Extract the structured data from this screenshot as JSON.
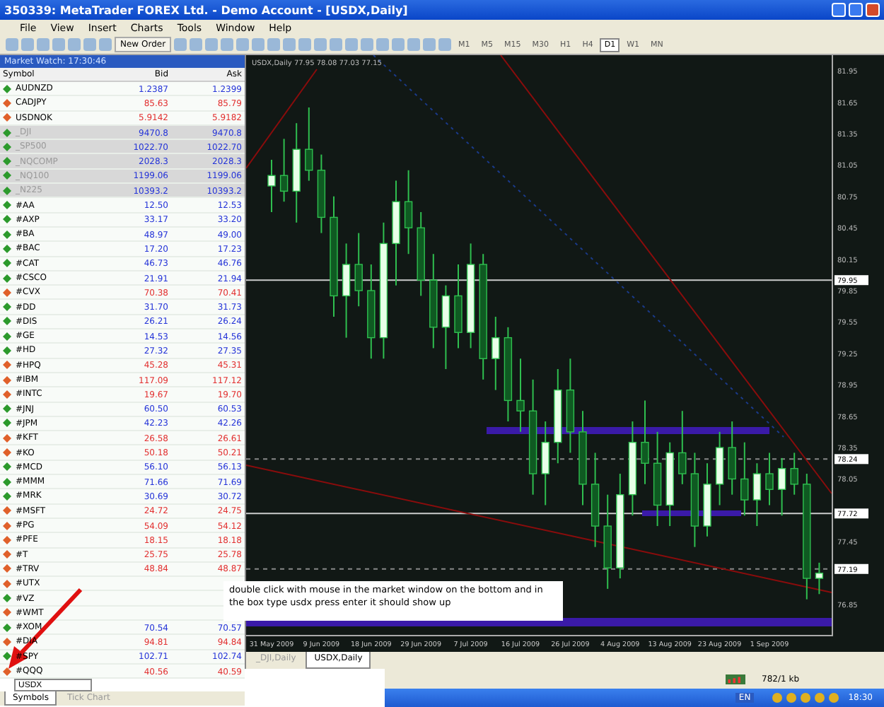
{
  "window": {
    "title": "350339: MetaTrader FOREX Ltd. - Demo Account - [USDX,Daily]"
  },
  "menu": [
    "File",
    "View",
    "Insert",
    "Charts",
    "Tools",
    "Window",
    "Help"
  ],
  "toolbar": {
    "new_order": "New Order",
    "timeframes": [
      {
        "label": "M1",
        "selected": false
      },
      {
        "label": "M5",
        "selected": false
      },
      {
        "label": "M15",
        "selected": false
      },
      {
        "label": "M30",
        "selected": false
      },
      {
        "label": "H1",
        "selected": false
      },
      {
        "label": "H4",
        "selected": false
      },
      {
        "label": "D1",
        "selected": true
      },
      {
        "label": "W1",
        "selected": false
      },
      {
        "label": "MN",
        "selected": false
      }
    ]
  },
  "watch": {
    "title": "Market Watch: 17:30:46",
    "columns": [
      "Symbol",
      "Bid",
      "Ask"
    ],
    "rows": [
      {
        "symbol": "AUDNZD",
        "bid": "1.2387",
        "ask": "1.2399",
        "kind": "up",
        "highlighted": false
      },
      {
        "symbol": "CADJPY",
        "bid": "85.63",
        "ask": "85.79",
        "kind": "down",
        "highlighted": false
      },
      {
        "symbol": "USDNOK",
        "bid": "5.9142",
        "ask": "5.9182",
        "kind": "down",
        "highlighted": false
      },
      {
        "symbol": "_DJI",
        "bid": "9470.8",
        "ask": "9470.8",
        "kind": "up",
        "highlighted": true
      },
      {
        "symbol": "_SP500",
        "bid": "1022.70",
        "ask": "1022.70",
        "kind": "up",
        "highlighted": true
      },
      {
        "symbol": "_NQCOMP",
        "bid": "2028.3",
        "ask": "2028.3",
        "kind": "up",
        "highlighted": true
      },
      {
        "symbol": "_NQ100",
        "bid": "1199.06",
        "ask": "1199.06",
        "kind": "up",
        "highlighted": true
      },
      {
        "symbol": "_N225",
        "bid": "10393.2",
        "ask": "10393.2",
        "kind": "up",
        "highlighted": true
      },
      {
        "symbol": "#AA",
        "bid": "12.50",
        "ask": "12.53",
        "kind": "up",
        "highlighted": false
      },
      {
        "symbol": "#AXP",
        "bid": "33.17",
        "ask": "33.20",
        "kind": "up",
        "highlighted": false
      },
      {
        "symbol": "#BA",
        "bid": "48.97",
        "ask": "49.00",
        "kind": "up",
        "highlighted": false
      },
      {
        "symbol": "#BAC",
        "bid": "17.20",
        "ask": "17.23",
        "kind": "up",
        "highlighted": false
      },
      {
        "symbol": "#CAT",
        "bid": "46.73",
        "ask": "46.76",
        "kind": "up",
        "highlighted": false
      },
      {
        "symbol": "#CSCO",
        "bid": "21.91",
        "ask": "21.94",
        "kind": "up",
        "highlighted": false
      },
      {
        "symbol": "#CVX",
        "bid": "70.38",
        "ask": "70.41",
        "kind": "down",
        "highlighted": false
      },
      {
        "symbol": "#DD",
        "bid": "31.70",
        "ask": "31.73",
        "kind": "up",
        "highlighted": false
      },
      {
        "symbol": "#DIS",
        "bid": "26.21",
        "ask": "26.24",
        "kind": "up",
        "highlighted": false
      },
      {
        "symbol": "#GE",
        "bid": "14.53",
        "ask": "14.56",
        "kind": "up",
        "highlighted": false
      },
      {
        "symbol": "#HD",
        "bid": "27.32",
        "ask": "27.35",
        "kind": "up",
        "highlighted": false
      },
      {
        "symbol": "#HPQ",
        "bid": "45.28",
        "ask": "45.31",
        "kind": "down",
        "highlighted": false
      },
      {
        "symbol": "#IBM",
        "bid": "117.09",
        "ask": "117.12",
        "kind": "down",
        "highlighted": false
      },
      {
        "symbol": "#INTC",
        "bid": "19.67",
        "ask": "19.70",
        "kind": "down",
        "highlighted": false
      },
      {
        "symbol": "#JNJ",
        "bid": "60.50",
        "ask": "60.53",
        "kind": "up",
        "highlighted": false
      },
      {
        "symbol": "#JPM",
        "bid": "42.23",
        "ask": "42.26",
        "kind": "up",
        "highlighted": false
      },
      {
        "symbol": "#KFT",
        "bid": "26.58",
        "ask": "26.61",
        "kind": "down",
        "highlighted": false
      },
      {
        "symbol": "#KO",
        "bid": "50.18",
        "ask": "50.21",
        "kind": "down",
        "highlighted": false
      },
      {
        "symbol": "#MCD",
        "bid": "56.10",
        "ask": "56.13",
        "kind": "up",
        "highlighted": false
      },
      {
        "symbol": "#MMM",
        "bid": "71.66",
        "ask": "71.69",
        "kind": "up",
        "highlighted": false
      },
      {
        "symbol": "#MRK",
        "bid": "30.69",
        "ask": "30.72",
        "kind": "up",
        "highlighted": false
      },
      {
        "symbol": "#MSFT",
        "bid": "24.72",
        "ask": "24.75",
        "kind": "down",
        "highlighted": false
      },
      {
        "symbol": "#PG",
        "bid": "54.09",
        "ask": "54.12",
        "kind": "down",
        "highlighted": false
      },
      {
        "symbol": "#PFE",
        "bid": "18.15",
        "ask": "18.18",
        "kind": "down",
        "highlighted": false
      },
      {
        "symbol": "#T",
        "bid": "25.75",
        "ask": "25.78",
        "kind": "down",
        "highlighted": false
      },
      {
        "symbol": "#TRV",
        "bid": "48.84",
        "ask": "48.87",
        "kind": "down",
        "highlighted": false
      },
      {
        "symbol": "#UTX",
        "kind": "down",
        "highlighted": false
      },
      {
        "symbol": "#VZ",
        "kind": "up",
        "highlighted": false
      },
      {
        "symbol": "#WMT",
        "kind": "down",
        "highlighted": false
      },
      {
        "symbol": "#XOM",
        "bid": "70.54",
        "ask": "70.57",
        "kind": "up",
        "highlighted": false
      },
      {
        "symbol": "#DIA",
        "bid": "94.81",
        "ask": "94.84",
        "kind": "down",
        "highlighted": false
      },
      {
        "symbol": "#SPY",
        "bid": "102.71",
        "ask": "102.74",
        "kind": "up",
        "highlighted": false
      },
      {
        "symbol": "#QQQ",
        "bid": "40.56",
        "ask": "40.59",
        "kind": "down",
        "highlighted": false
      }
    ],
    "input": "USDX",
    "tabs": [
      {
        "label": "Symbols",
        "selected": true
      },
      {
        "label": "Tick Chart",
        "selected": false
      }
    ]
  },
  "note": "double click with mouse in the market window on the bottom and in the box type usdx press enter it should show up",
  "chart": {
    "header": "USDX,Daily  77.95 78.08 77.03 77.15",
    "markers": [
      {
        "text": "79.95",
        "kind": "solid"
      },
      {
        "text": "78.24",
        "kind": "dashed"
      },
      {
        "text": "77.72",
        "kind": "solid"
      },
      {
        "text": "77.19",
        "kind": "dashed"
      }
    ],
    "chart_data": {
      "type": "candlestick",
      "ylim": [
        76.56,
        82.1
      ],
      "categories": [
        "31 May 2009",
        null,
        null,
        null,
        "9 Jun 2009",
        null,
        null,
        null,
        "18 Jun 2009",
        null,
        null,
        null,
        "29 Jun 2009",
        null,
        null,
        null,
        "7 Jul 2009",
        null,
        null,
        null,
        "16 Jul 2009",
        null,
        null,
        null,
        "26 Jul 2009",
        null,
        null,
        null,
        "4 Aug 2009",
        null,
        null,
        null,
        "13 Aug 2009",
        null,
        null,
        null,
        "23 Aug 2009",
        null,
        null,
        null,
        "1 Sep 2009",
        null,
        null,
        null,
        null
      ],
      "yticks": [
        81.95,
        81.65,
        81.35,
        81.05,
        80.75,
        80.45,
        80.15,
        79.85,
        79.55,
        79.25,
        78.95,
        78.65,
        78.35,
        78.05,
        77.45,
        76.85
      ],
      "ohlc": [
        [
          80.85,
          81.1,
          80.6,
          80.95
        ],
        [
          80.95,
          81.3,
          80.7,
          80.8
        ],
        [
          80.8,
          81.45,
          80.5,
          81.2
        ],
        [
          81.2,
          81.6,
          80.9,
          81.0
        ],
        [
          81.0,
          81.15,
          80.4,
          80.55
        ],
        [
          80.55,
          80.75,
          79.6,
          79.8
        ],
        [
          79.8,
          80.3,
          79.4,
          80.1
        ],
        [
          80.1,
          80.4,
          79.7,
          79.85
        ],
        [
          79.85,
          80.1,
          79.2,
          79.4
        ],
        [
          79.4,
          80.5,
          79.2,
          80.3
        ],
        [
          80.3,
          80.9,
          79.9,
          80.7
        ],
        [
          80.7,
          81.0,
          80.2,
          80.45
        ],
        [
          80.45,
          80.6,
          79.8,
          79.95
        ],
        [
          79.95,
          80.2,
          79.3,
          79.5
        ],
        [
          79.5,
          79.9,
          79.1,
          79.8
        ],
        [
          79.8,
          80.1,
          79.3,
          79.45
        ],
        [
          79.45,
          80.3,
          79.3,
          80.1
        ],
        [
          80.1,
          80.2,
          79.0,
          79.2
        ],
        [
          79.2,
          79.6,
          78.9,
          79.4
        ],
        [
          79.4,
          79.5,
          78.6,
          78.8
        ],
        [
          78.8,
          79.2,
          78.5,
          78.7
        ],
        [
          78.7,
          79.0,
          77.9,
          78.1
        ],
        [
          78.1,
          78.6,
          77.8,
          78.4
        ],
        [
          78.4,
          79.1,
          78.2,
          78.9
        ],
        [
          78.9,
          79.2,
          78.3,
          78.5
        ],
        [
          78.5,
          78.7,
          77.8,
          78.0
        ],
        [
          78.0,
          78.3,
          77.4,
          77.6
        ],
        [
          77.6,
          77.9,
          77.0,
          77.2
        ],
        [
          77.2,
          78.1,
          77.1,
          77.9
        ],
        [
          77.9,
          78.6,
          77.7,
          78.4
        ],
        [
          78.4,
          78.8,
          78.0,
          78.2
        ],
        [
          78.2,
          78.5,
          77.6,
          77.8
        ],
        [
          77.8,
          78.4,
          77.6,
          78.3
        ],
        [
          78.3,
          78.7,
          78.0,
          78.1
        ],
        [
          78.1,
          78.3,
          77.4,
          77.6
        ],
        [
          77.6,
          78.2,
          77.5,
          78.0
        ],
        [
          78.0,
          78.5,
          77.8,
          78.35
        ],
        [
          78.35,
          78.6,
          77.9,
          78.05
        ],
        [
          78.05,
          78.4,
          77.7,
          77.85
        ],
        [
          77.85,
          78.2,
          77.6,
          78.1
        ],
        [
          78.1,
          78.3,
          77.8,
          77.95
        ],
        [
          77.95,
          78.25,
          77.7,
          78.15
        ],
        [
          78.15,
          78.3,
          77.9,
          78.0
        ],
        [
          78.0,
          78.1,
          76.9,
          77.1
        ],
        [
          77.1,
          77.25,
          76.95,
          77.15
        ]
      ]
    },
    "tabs": [
      {
        "label": "_DJI,Daily",
        "selected": false
      },
      {
        "label": "USDX,Daily",
        "selected": true
      }
    ]
  },
  "status": {
    "traffic": "782/1 kb"
  },
  "taskbar": {
    "language": "EN",
    "time": "18:30"
  }
}
